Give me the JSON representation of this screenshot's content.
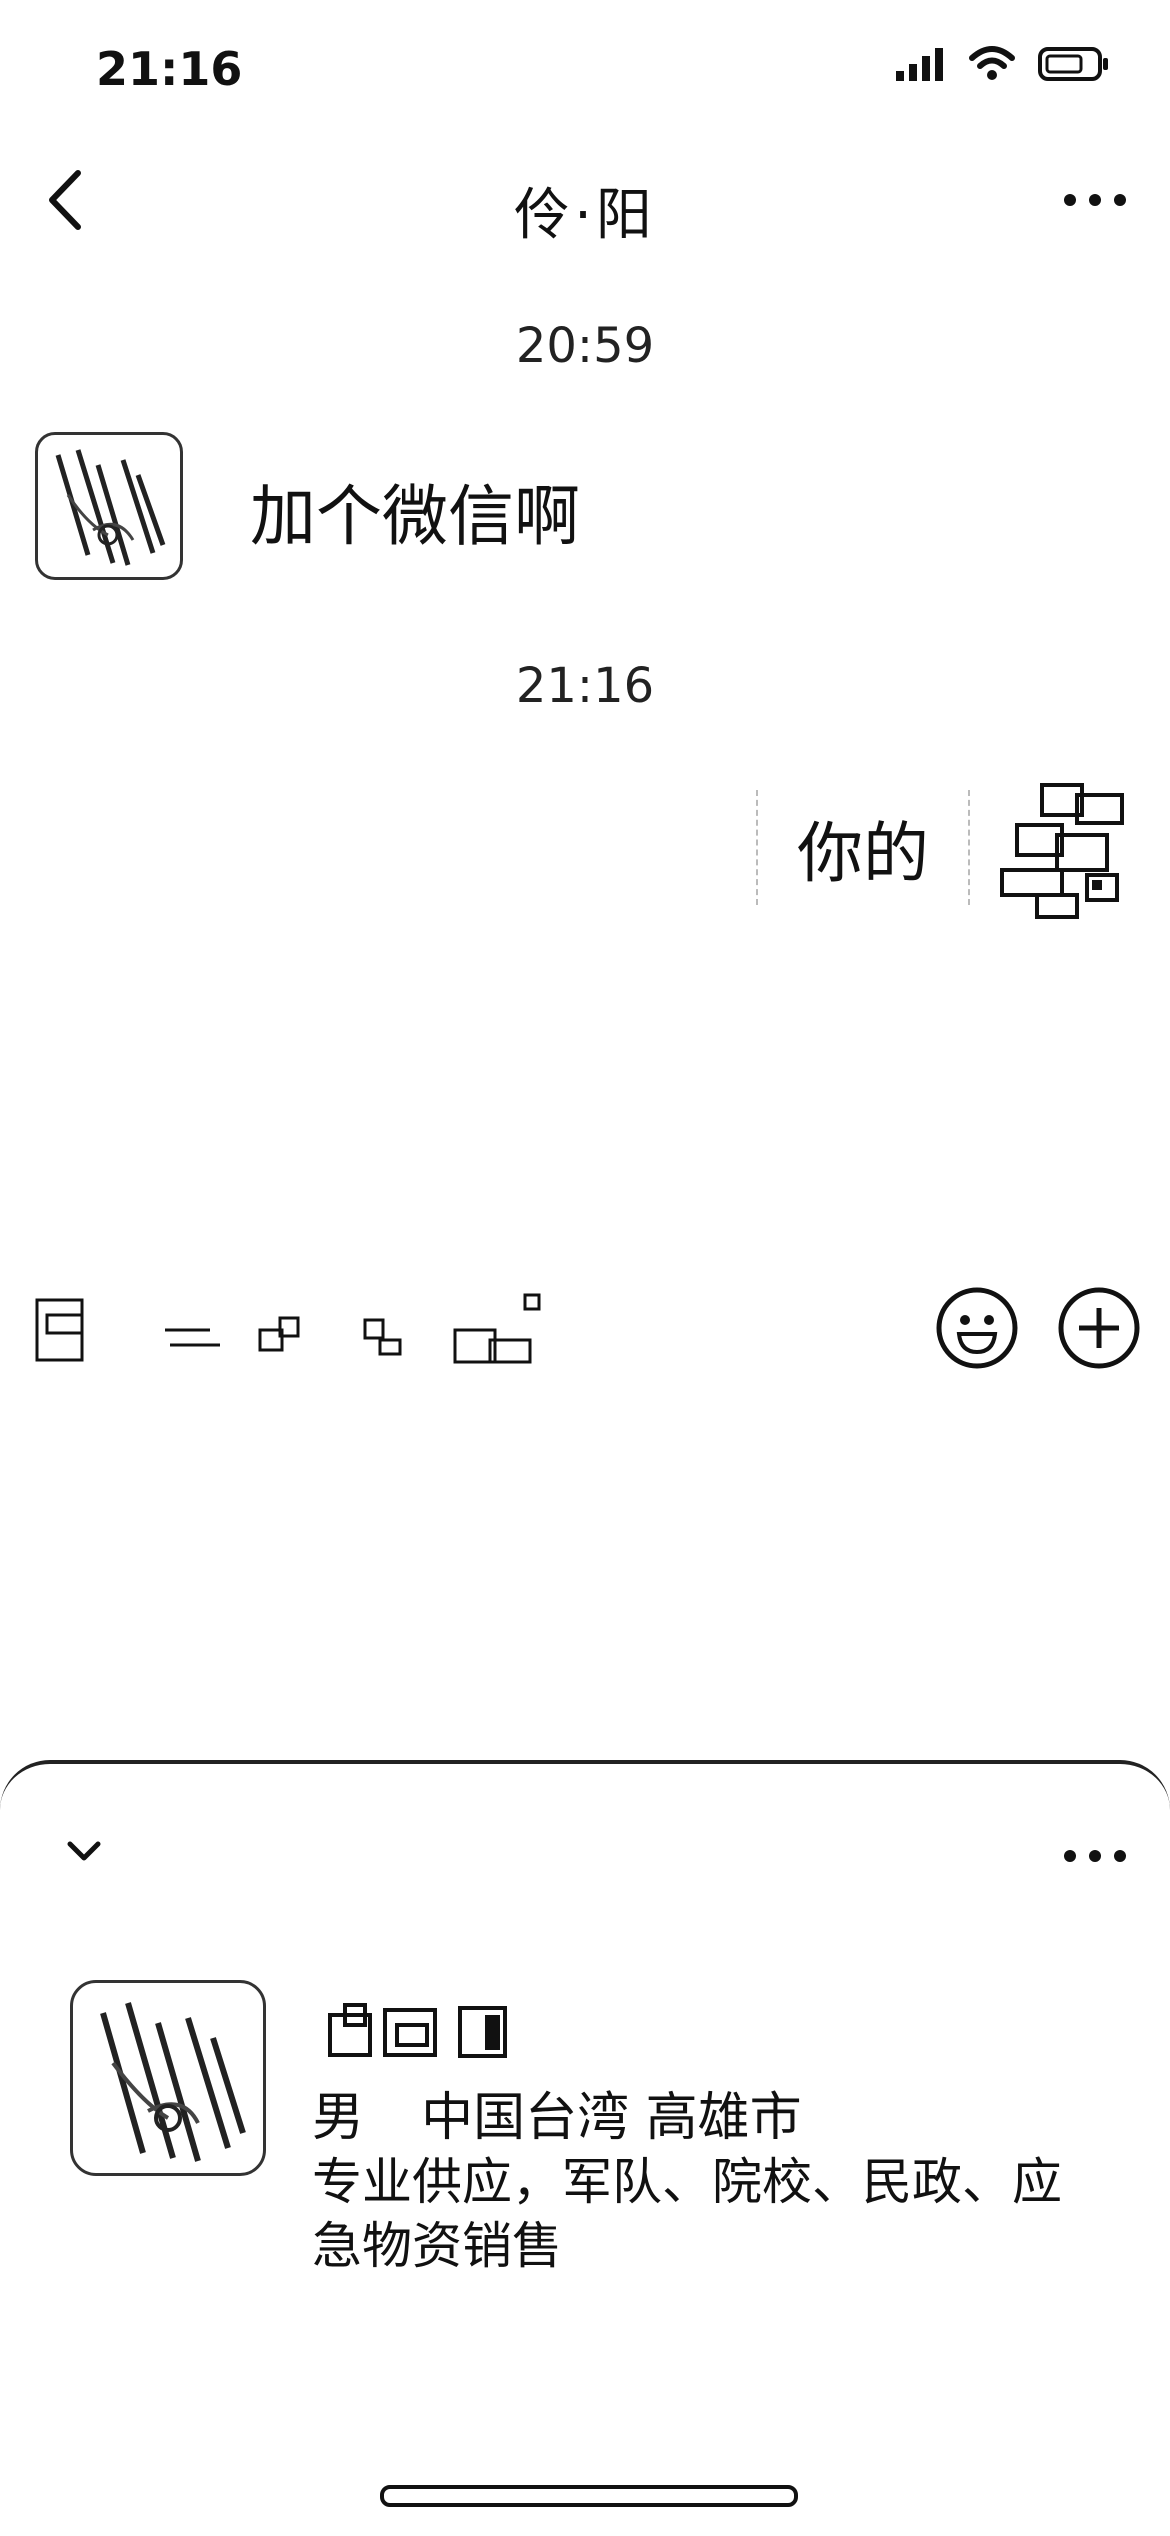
{
  "status_bar": {
    "time": "21:16"
  },
  "nav": {
    "title": "伶·阳"
  },
  "messages": [
    {
      "time": "20:59",
      "side": "left",
      "text": "加个微信啊"
    },
    {
      "time": "21:16",
      "side": "right",
      "text": "你的"
    }
  ],
  "profile": {
    "gender": "男",
    "location": "中国台湾 高雄市",
    "bio": "专业供应，军队、院校、民政、应急物资销售"
  },
  "icons": {
    "back": "chevron-left-icon",
    "more": "more-dots-icon",
    "emoji": "emoji-icon",
    "add": "plus-circle-icon",
    "collapse": "chevron-down-icon"
  }
}
